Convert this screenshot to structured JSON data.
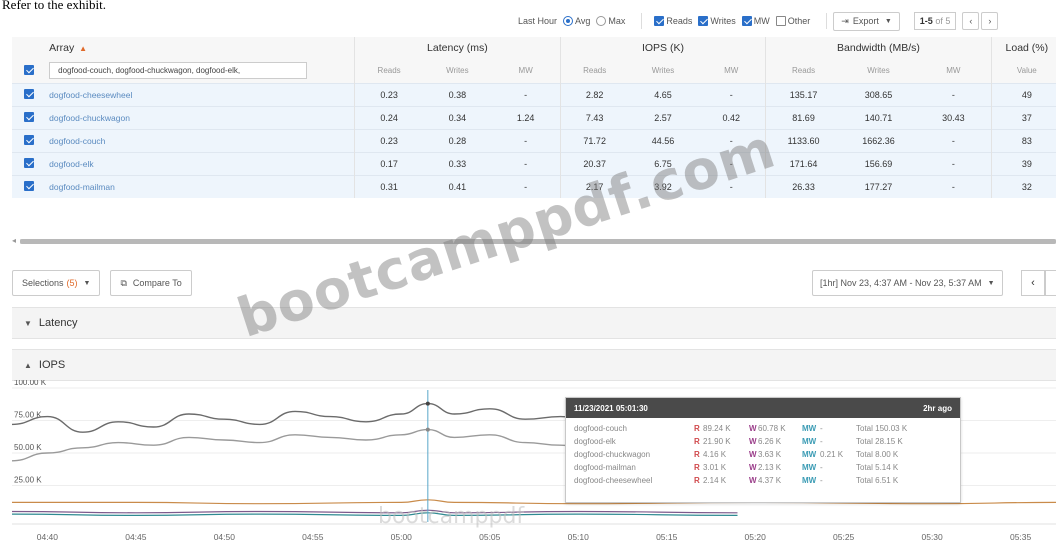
{
  "caption": "Refer to the exhibit.",
  "toolbar": {
    "time_range": "Last Hour",
    "avg_label": "Avg",
    "max_label": "Max",
    "avg_selected": true,
    "reads_label": "Reads",
    "writes_label": "Writes",
    "mw_label": "MW",
    "other_label": "Other",
    "reads_checked": true,
    "writes_checked": true,
    "mw_checked": true,
    "other_checked": false,
    "export_label": "Export",
    "pager_range": "1-5",
    "pager_of": "of 5"
  },
  "table": {
    "array_header": "Array",
    "filter_value": "dogfood-couch, dogfood-chuckwagon, dogfood-elk,",
    "groups": {
      "latency": "Latency (ms)",
      "iops": "IOPS (K)",
      "bandwidth": "Bandwidth (MB/s)",
      "load": "Load (%)"
    },
    "subheaders": {
      "reads": "Reads",
      "writes": "Writes",
      "mw": "MW",
      "value": "Value"
    },
    "rows": [
      {
        "name": "dogfood-cheesewheel",
        "lat_r": "0.23",
        "lat_w": "0.38",
        "lat_mw": "-",
        "iops_r": "2.82",
        "iops_w": "4.65",
        "iops_mw": "-",
        "bw_r": "135.17",
        "bw_w": "308.65",
        "bw_mw": "-",
        "load": "49"
      },
      {
        "name": "dogfood-chuckwagon",
        "lat_r": "0.24",
        "lat_w": "0.34",
        "lat_mw": "1.24",
        "iops_r": "7.43",
        "iops_w": "2.57",
        "iops_mw": "0.42",
        "bw_r": "81.69",
        "bw_w": "140.71",
        "bw_mw": "30.43",
        "load": "37"
      },
      {
        "name": "dogfood-couch",
        "lat_r": "0.23",
        "lat_w": "0.28",
        "lat_mw": "-",
        "iops_r": "71.72",
        "iops_w": "44.56",
        "iops_mw": "-",
        "bw_r": "1133.60",
        "bw_w": "1662.36",
        "bw_mw": "-",
        "load": "83"
      },
      {
        "name": "dogfood-elk",
        "lat_r": "0.17",
        "lat_w": "0.33",
        "lat_mw": "-",
        "iops_r": "20.37",
        "iops_w": "6.75",
        "iops_mw": "-",
        "bw_r": "171.64",
        "bw_w": "156.69",
        "bw_mw": "-",
        "load": "39"
      },
      {
        "name": "dogfood-mailman",
        "lat_r": "0.31",
        "lat_w": "0.41",
        "lat_mw": "-",
        "iops_r": "2.17",
        "iops_w": "3.92",
        "iops_mw": "-",
        "bw_r": "26.33",
        "bw_w": "177.27",
        "bw_mw": "-",
        "load": "32"
      }
    ]
  },
  "selections": {
    "label": "Selections",
    "count": "(5)",
    "compare_label": "Compare To",
    "range_label": "[1hr] Nov 23, 4:37 AM - Nov 23, 5:37 AM"
  },
  "sections": {
    "latency": "Latency",
    "iops": "IOPS"
  },
  "tooltip": {
    "timestamp": "11/23/2021 05:01:30",
    "ago": "2hr ago",
    "rows": [
      {
        "name": "dogfood-couch",
        "r": "89.24 K",
        "w": "60.78 K",
        "mw": "-",
        "total": "Total 150.03 K"
      },
      {
        "name": "dogfood-elk",
        "r": "21.90 K",
        "w": "6.26 K",
        "mw": "-",
        "total": "Total 28.15 K"
      },
      {
        "name": "dogfood-chuckwagon",
        "r": "4.16 K",
        "w": "3.63 K",
        "mw": "0.21 K",
        "total": "Total 8.00 K"
      },
      {
        "name": "dogfood-mailman",
        "r": "3.01 K",
        "w": "2.13 K",
        "mw": "-",
        "total": "Total 5.14 K"
      },
      {
        "name": "dogfood-cheesewheel",
        "r": "2.14 K",
        "w": "4.37 K",
        "mw": "-",
        "total": "Total 6.51 K"
      }
    ],
    "label_r": "R",
    "label_w": "W",
    "label_mw": "MW"
  },
  "chart_data": {
    "type": "line",
    "y_ticks": [
      "100.00 K",
      "75.00 K",
      "50.00 K",
      "25.00 K"
    ],
    "ylim": [
      0,
      100
    ],
    "x_ticks": [
      "04:40",
      "04:45",
      "04:50",
      "04:55",
      "05:00",
      "05:05",
      "05:10",
      "05:15",
      "05:20",
      "05:25",
      "05:30",
      "05:35"
    ],
    "x_minutes": [
      40,
      45,
      50,
      55,
      60,
      65,
      70,
      75,
      80,
      85,
      90,
      95
    ],
    "xlim": [
      38,
      97
    ],
    "cursor_minute": 61.5,
    "series": [
      {
        "name": "dogfood-couch",
        "color": "#6b6b6b",
        "x": [
          38,
          40,
          42,
          44,
          46,
          48,
          50,
          52,
          54,
          56,
          58,
          60,
          61.5,
          63,
          65,
          67,
          69,
          71,
          73,
          75,
          77,
          79
        ],
        "y": [
          72,
          78,
          66,
          74,
          70,
          80,
          76,
          72,
          82,
          78,
          74,
          80,
          88,
          80,
          84,
          76,
          78,
          74,
          82,
          80,
          86,
          84
        ]
      },
      {
        "name": "dogfood-elk",
        "color": "#9a9a9a",
        "x": [
          38,
          40,
          42,
          44,
          46,
          48,
          50,
          52,
          54,
          56,
          58,
          60,
          61.5,
          63,
          65,
          67,
          69,
          71,
          73,
          75,
          77,
          79
        ],
        "y": [
          44,
          50,
          54,
          58,
          56,
          62,
          60,
          58,
          64,
          62,
          60,
          64,
          68,
          62,
          64,
          58,
          56,
          54,
          52,
          50,
          48,
          46
        ]
      },
      {
        "name": "dogfood-chuckwagon",
        "color": "#c98b4a",
        "x": [
          38,
          45,
          52,
          60,
          61.5,
          63,
          70,
          80,
          90,
          97
        ],
        "y": [
          12,
          12,
          11,
          12,
          14,
          12,
          11,
          12,
          11,
          12
        ]
      },
      {
        "name": "dogfood-mailman",
        "color": "#7d5a8c",
        "x": [
          38,
          45,
          52,
          60,
          61.5,
          63,
          70,
          79
        ],
        "y": [
          5,
          4,
          5,
          4,
          6,
          4,
          5,
          4
        ]
      },
      {
        "name": "dogfood-cheesewheel",
        "color": "#2f8a92",
        "x": [
          38,
          45,
          52,
          60,
          61.5,
          63,
          70,
          79
        ],
        "y": [
          3,
          2,
          3,
          2,
          4,
          2,
          3,
          2
        ]
      }
    ]
  },
  "watermark": "bootcamppdf.com",
  "watermark2": "bootcamppdf"
}
